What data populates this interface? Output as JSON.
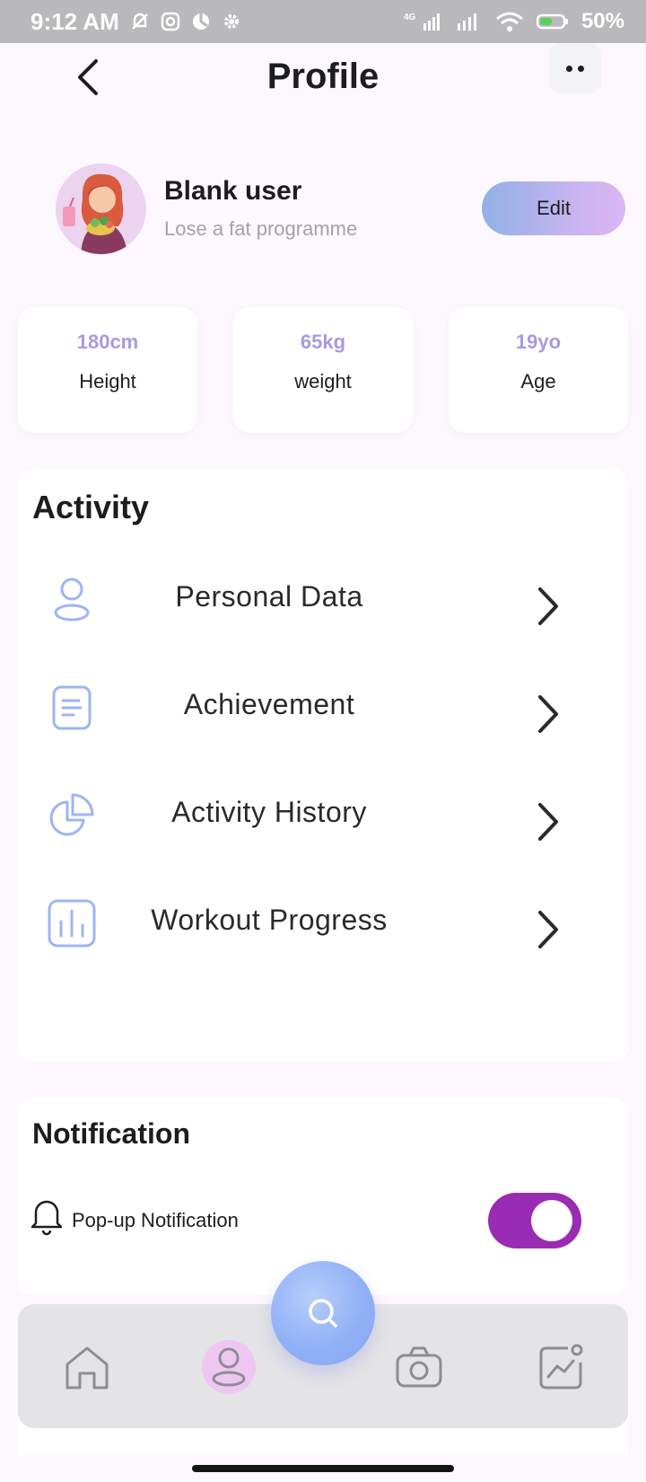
{
  "status_bar": {
    "time": "9:12 AM",
    "battery": "50%",
    "network": "4G"
  },
  "header": {
    "title": "Profile"
  },
  "profile": {
    "name": "Blank user",
    "program": "Lose a fat programme",
    "edit_label": "Edit"
  },
  "stats": [
    {
      "value": "180cm",
      "label": "Height"
    },
    {
      "value": "65kg",
      "label": "weight"
    },
    {
      "value": "19yo",
      "label": "Age"
    }
  ],
  "activity": {
    "title": "Activity",
    "items": [
      {
        "label": "Personal Data",
        "icon": "person-icon"
      },
      {
        "label": "Achievement",
        "icon": "document-icon"
      },
      {
        "label": "Activity History",
        "icon": "pie-chart-icon"
      },
      {
        "label": "Workout Progress",
        "icon": "bar-chart-icon"
      }
    ]
  },
  "notification": {
    "title": "Notification",
    "popup_label": "Pop-up Notification",
    "popup_enabled": true
  },
  "nav": {
    "items": [
      "home-icon",
      "profile-icon",
      "search-icon",
      "camera-icon",
      "chart-icon"
    ]
  },
  "colors": {
    "accent": "#a89ae0",
    "toggle_on": "#9a2bb3",
    "icon_blue": "#9db5f2",
    "status_bar": "#b9b8bb"
  }
}
